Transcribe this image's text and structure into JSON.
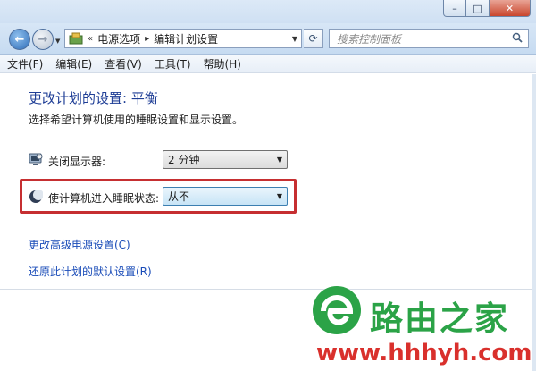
{
  "nav": {
    "breadcrumb_overflow": "«",
    "breadcrumb": [
      "电源选项",
      "编辑计划设置"
    ],
    "search_placeholder": "搜索控制面板"
  },
  "menu": [
    "文件(F)",
    "编辑(E)",
    "查看(V)",
    "工具(T)",
    "帮助(H)"
  ],
  "content": {
    "title": "更改计划的设置: 平衡",
    "description": "选择希望计算机使用的睡眠设置和显示设置。",
    "display_off": {
      "label": "关闭显示器:",
      "value": "2 分钟"
    },
    "sleep": {
      "label": "使计算机进入睡眠状态:",
      "value": "从不"
    },
    "link_advanced": "更改高级电源设置(C)",
    "link_restore": "还原此计划的默认设置(R)"
  },
  "watermark": {
    "title": "路由之家",
    "url": "www.hhhyh.com"
  },
  "colors": {
    "accent": "#1f3e96",
    "link": "#1a4cb8",
    "highlight": "#c62f31",
    "watermark_green": "#2ba347",
    "watermark_red": "#d9302c"
  },
  "icons": [
    "back-arrow-icon",
    "forward-arrow-icon",
    "control-panel-icon",
    "refresh-icon",
    "search-icon",
    "monitor-icon",
    "moon-sleep-icon",
    "minimize-icon",
    "maximize-icon",
    "close-icon"
  ]
}
